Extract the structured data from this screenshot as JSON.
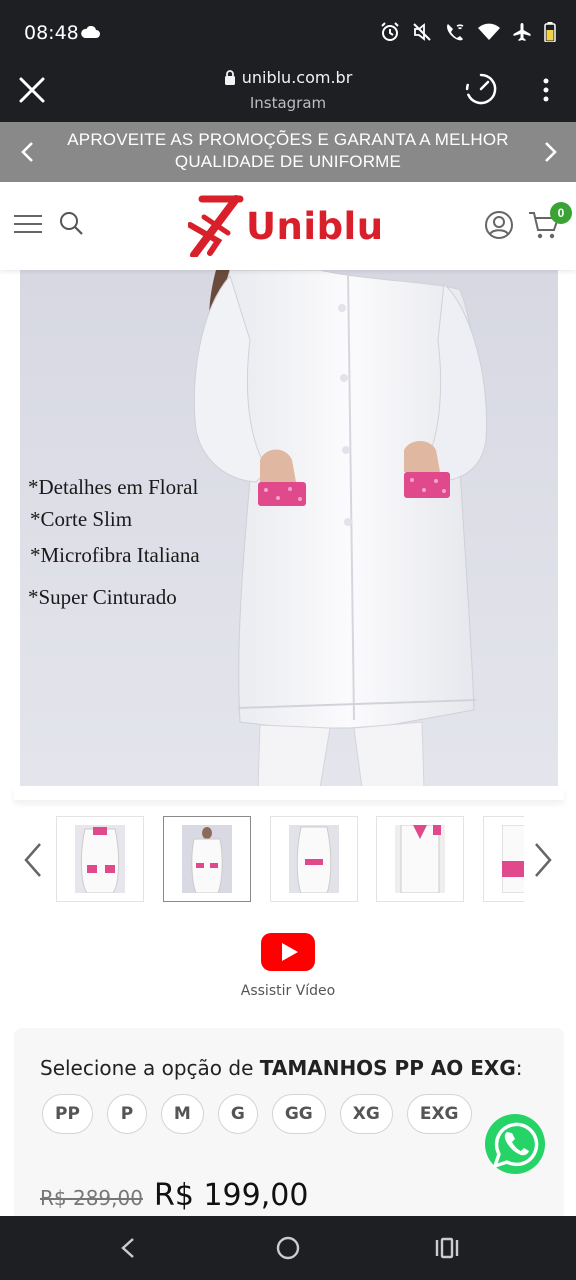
{
  "status_bar": {
    "time": "08:48",
    "icons": [
      "cloud-icon",
      "alarm-icon",
      "mute-icon",
      "wifi-call-icon",
      "wifi-icon",
      "airplane-icon",
      "battery-icon"
    ]
  },
  "browser": {
    "url": "uniblu.com.br",
    "subtitle": "Instagram"
  },
  "promo": {
    "text": "APROVEITE AS PROMOÇÕES E GARANTA A MELHOR QUALIDADE DE UNIFORME"
  },
  "header": {
    "logo_text": "Uniblu",
    "cart_count": "0",
    "brand_color": "#d81f2a"
  },
  "product": {
    "features": [
      "*Detalhes em Floral",
      "*Corte Slim",
      "*Microfibra Italiana",
      "*Super Cinturado"
    ]
  },
  "video": {
    "label": "Assistir Vídeo"
  },
  "variation": {
    "label_prefix": "Selecione a opção de ",
    "label_strong": "TAMANHOS PP AO EXG",
    "label_suffix": ":",
    "sizes": [
      "PP",
      "P",
      "M",
      "G",
      "GG",
      "XG",
      "EXG"
    ]
  },
  "price": {
    "old": "R$ 289,00",
    "new": "R$ 199,00"
  }
}
